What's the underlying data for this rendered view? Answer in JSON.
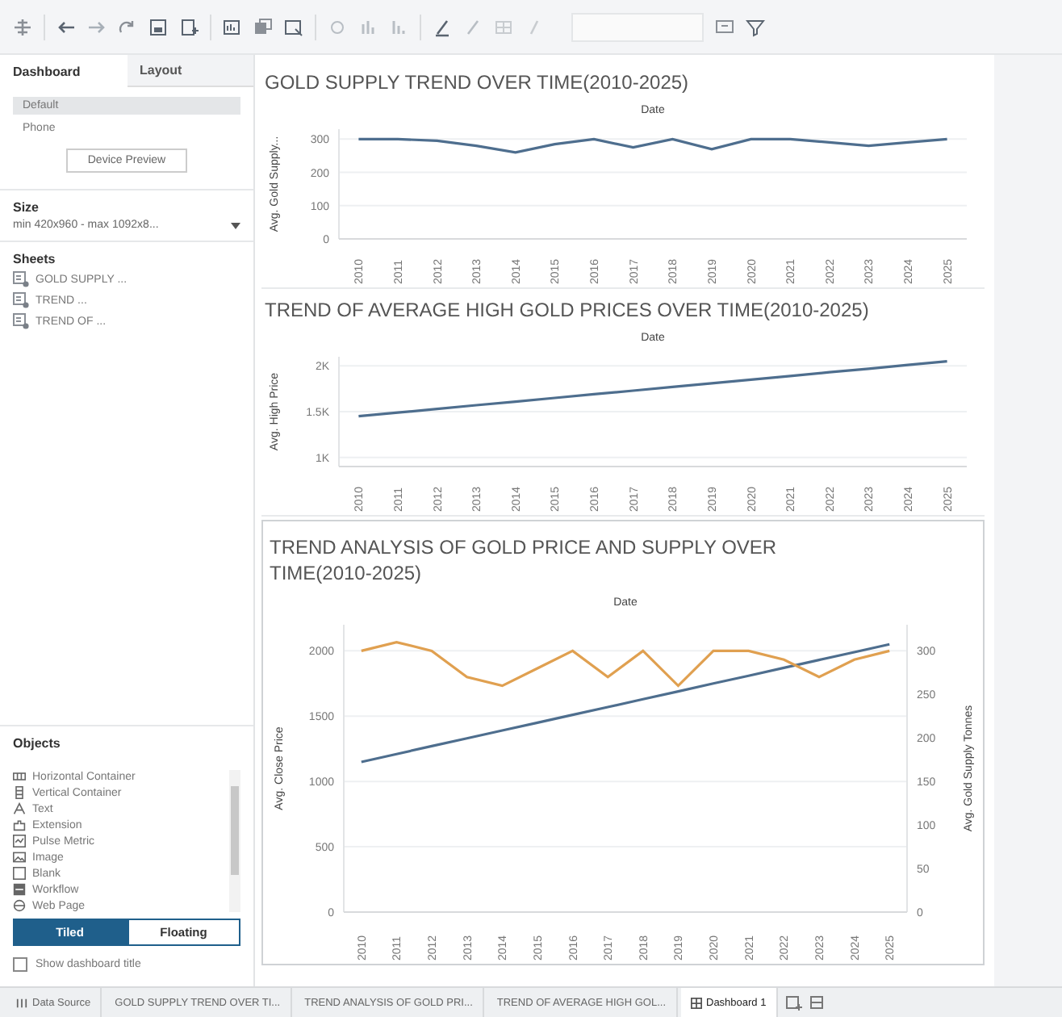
{
  "sidebar": {
    "tabs": [
      {
        "label": "Dashboard",
        "selected": true
      },
      {
        "label": "Layout",
        "selected": false
      }
    ],
    "devices": [
      {
        "label": "Default",
        "selected": true
      },
      {
        "label": "Phone",
        "selected": false
      }
    ],
    "device_preview_button": "Device Preview",
    "size": {
      "heading": "Size",
      "value": "min 420x960 - max 1092x8..."
    },
    "sheets": {
      "heading": "Sheets",
      "items": [
        "GOLD SUPPLY ...",
        "TREND ...",
        "TREND OF ..."
      ]
    },
    "objects": {
      "heading": "Objects",
      "items": [
        {
          "label": "Horizontal Container",
          "kind": "hcontainer"
        },
        {
          "label": "Vertical Container",
          "kind": "vcontainer"
        },
        {
          "label": "Text",
          "kind": "text"
        },
        {
          "label": "Extension",
          "kind": "extension"
        },
        {
          "label": "Pulse Metric",
          "kind": "pulse"
        },
        {
          "label": "Image",
          "kind": "image"
        },
        {
          "label": "Blank",
          "kind": "blank"
        },
        {
          "label": "Workflow",
          "kind": "workflow"
        },
        {
          "label": "Web Page",
          "kind": "web"
        }
      ]
    },
    "layout_modes": [
      {
        "label": "Tiled",
        "selected": true
      },
      {
        "label": "Floating",
        "selected": false
      }
    ],
    "show_title": {
      "label": "Show dashboard title",
      "checked": false
    }
  },
  "charts": [
    {
      "title": "GOLD SUPPLY TREND OVER TIME(2010-2025)",
      "chart_data": {
        "type": "line",
        "xlabel": "Date",
        "ylabel": "Avg. Gold Supply...",
        "categories": [
          "2010",
          "2011",
          "2012",
          "2013",
          "2014",
          "2015",
          "2016",
          "2017",
          "2018",
          "2019",
          "2020",
          "2021",
          "2022",
          "2023",
          "2024",
          "2025"
        ],
        "series": [
          {
            "color": "#4e6e8e",
            "values": [
              300,
              300,
              295,
              280,
              260,
              285,
              300,
              275,
              300,
              270,
              300,
              300,
              290,
              280,
              290,
              300
            ]
          }
        ],
        "ylim": [
          0,
          330
        ],
        "yticks": [
          0,
          100,
          200,
          300
        ],
        "grid": true
      }
    },
    {
      "title": "TREND OF AVERAGE HIGH GOLD PRICES OVER TIME(2010-2025)",
      "chart_data": {
        "type": "line",
        "xlabel": "Date",
        "ylabel": "Avg. High Price",
        "categories": [
          "2010",
          "2011",
          "2012",
          "2013",
          "2014",
          "2015",
          "2016",
          "2017",
          "2018",
          "2019",
          "2020",
          "2021",
          "2022",
          "2023",
          "2024",
          "2025"
        ],
        "series": [
          {
            "color": "#4e6e8e",
            "values": [
              1450,
              1490,
              1530,
              1570,
              1610,
              1650,
              1690,
              1730,
              1770,
              1810,
              1850,
              1890,
              1930,
              1970,
              2010,
              2050
            ]
          }
        ],
        "ylim": [
          900,
          2100
        ],
        "yticks": [
          {
            "value": 1000,
            "label": "1K"
          },
          {
            "value": 1500,
            "label": "1.5K"
          },
          {
            "value": 2000,
            "label": "2K"
          }
        ],
        "grid": true
      }
    },
    {
      "title": "TREND ANALYSIS OF GOLD PRICE AND SUPPLY OVER TIME(2010-2025)",
      "chart_data": {
        "type": "line",
        "xlabel": "Date",
        "ylabel": "Avg. Close Price",
        "y2label": "Avg. Gold Supply Tonnes",
        "categories": [
          "2010",
          "2011",
          "2012",
          "2013",
          "2014",
          "2015",
          "2016",
          "2017",
          "2018",
          "2019",
          "2020",
          "2021",
          "2022",
          "2023",
          "2024",
          "2025"
        ],
        "series": [
          {
            "color": "#4e6e8e",
            "values": [
              1150,
              1210,
              1270,
              1330,
              1390,
              1450,
              1510,
              1570,
              1630,
              1690,
              1750,
              1810,
              1870,
              1930,
              1990,
              2050
            ]
          },
          {
            "color": "#e0a050",
            "axis": "y2",
            "values": [
              300,
              310,
              300,
              270,
              260,
              280,
              300,
              270,
              300,
              260,
              300,
              300,
              290,
              270,
              290,
              300
            ]
          }
        ],
        "ylim": [
          0,
          2200
        ],
        "yticks": [
          0,
          500,
          1000,
          1500,
          2000
        ],
        "y2lim": [
          0,
          330
        ],
        "y2ticks": [
          0,
          50,
          100,
          150,
          200,
          250,
          300
        ],
        "grid": true
      }
    }
  ],
  "bottom_tabs": [
    {
      "label": "Data Source",
      "kind": "datasource",
      "selected": false
    },
    {
      "label": "GOLD SUPPLY TREND OVER TI...",
      "kind": "sheet",
      "selected": false
    },
    {
      "label": "TREND ANALYSIS OF GOLD PRI...",
      "kind": "sheet",
      "selected": false
    },
    {
      "label": "TREND OF AVERAGE HIGH GOL...",
      "kind": "sheet",
      "selected": false
    },
    {
      "label": "Dashboard 1",
      "kind": "dashboard",
      "selected": true
    }
  ]
}
